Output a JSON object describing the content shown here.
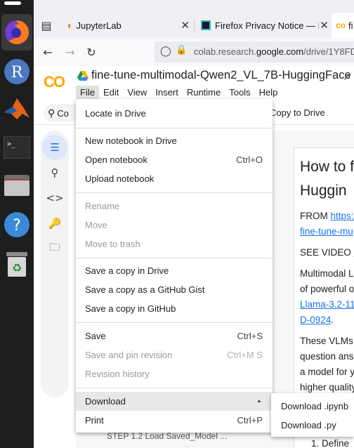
{
  "browser": {
    "tabs": [
      {
        "title": "JupyterLab"
      },
      {
        "title": "Firefox Privacy Notice — F"
      },
      {
        "title": "fi"
      }
    ],
    "url_prefix": "colab.research.",
    "url_domain": "google.com",
    "url_path": "/drive/1Y8FD"
  },
  "colab": {
    "logo": "CO",
    "notebook_title": "fine-tune-multimodal-Qwen2_VL_7B-HuggingFace",
    "menus": [
      "File",
      "Edit",
      "View",
      "Insert",
      "Runtime",
      "Tools",
      "Help"
    ],
    "search_label": "Co",
    "copy_to_drive": "Copy to Drive"
  },
  "file_menu": {
    "group1": [
      {
        "label": "Locate in Drive",
        "enabled": true
      }
    ],
    "group2": [
      {
        "label": "New notebook in Drive",
        "enabled": true,
        "shortcut": ""
      },
      {
        "label": "Open notebook",
        "enabled": true,
        "shortcut": "Ctrl+O"
      },
      {
        "label": "Upload notebook",
        "enabled": true,
        "shortcut": ""
      }
    ],
    "group3": [
      {
        "label": "Rename",
        "enabled": false
      },
      {
        "label": "Move",
        "enabled": false
      },
      {
        "label": "Move to trash",
        "enabled": false
      }
    ],
    "group4": [
      {
        "label": "Save a copy in Drive",
        "enabled": true
      },
      {
        "label": "Save a copy as a GitHub Gist",
        "enabled": true
      },
      {
        "label": "Save a copy in GitHub",
        "enabled": true
      }
    ],
    "group5": [
      {
        "label": "Save",
        "enabled": true,
        "shortcut": "Ctrl+S"
      },
      {
        "label": "Save and pin revision",
        "enabled": false,
        "shortcut": "Ctrl+M S"
      },
      {
        "label": "Revision history",
        "enabled": false,
        "shortcut": ""
      }
    ],
    "group6": [
      {
        "label": "Download",
        "enabled": true,
        "arrow": "▸"
      },
      {
        "label": "Print",
        "enabled": true,
        "shortcut": "Ctrl+P"
      }
    ]
  },
  "download_submenu": [
    "Download .ipynb",
    "Download .py"
  ],
  "notebook_cell": {
    "heading_line1": "How to f",
    "heading_line2": "Huggin",
    "from_label": "FROM ",
    "from_link": "https:/",
    "from_link2": "fine-tune-mu",
    "see_video": "SEE VIDEO ",
    "see_video_link": "ht",
    "multimodal_line1": "Multimodal L",
    "multimodal_line2": "of powerful o",
    "llama_link1": "Llama-3.2-11",
    "llama_link2": "D-0924",
    "llama_dot": ".",
    "vlms_line1": "These VLMs c",
    "vlms_line2": "question ans",
    "vlms_line3": "a model for y",
    "vlms_line4": "higher quality"
  },
  "background_cell_text": "STEP 1.2 Load Saved_Model ...",
  "background_list_item": "1. Define"
}
